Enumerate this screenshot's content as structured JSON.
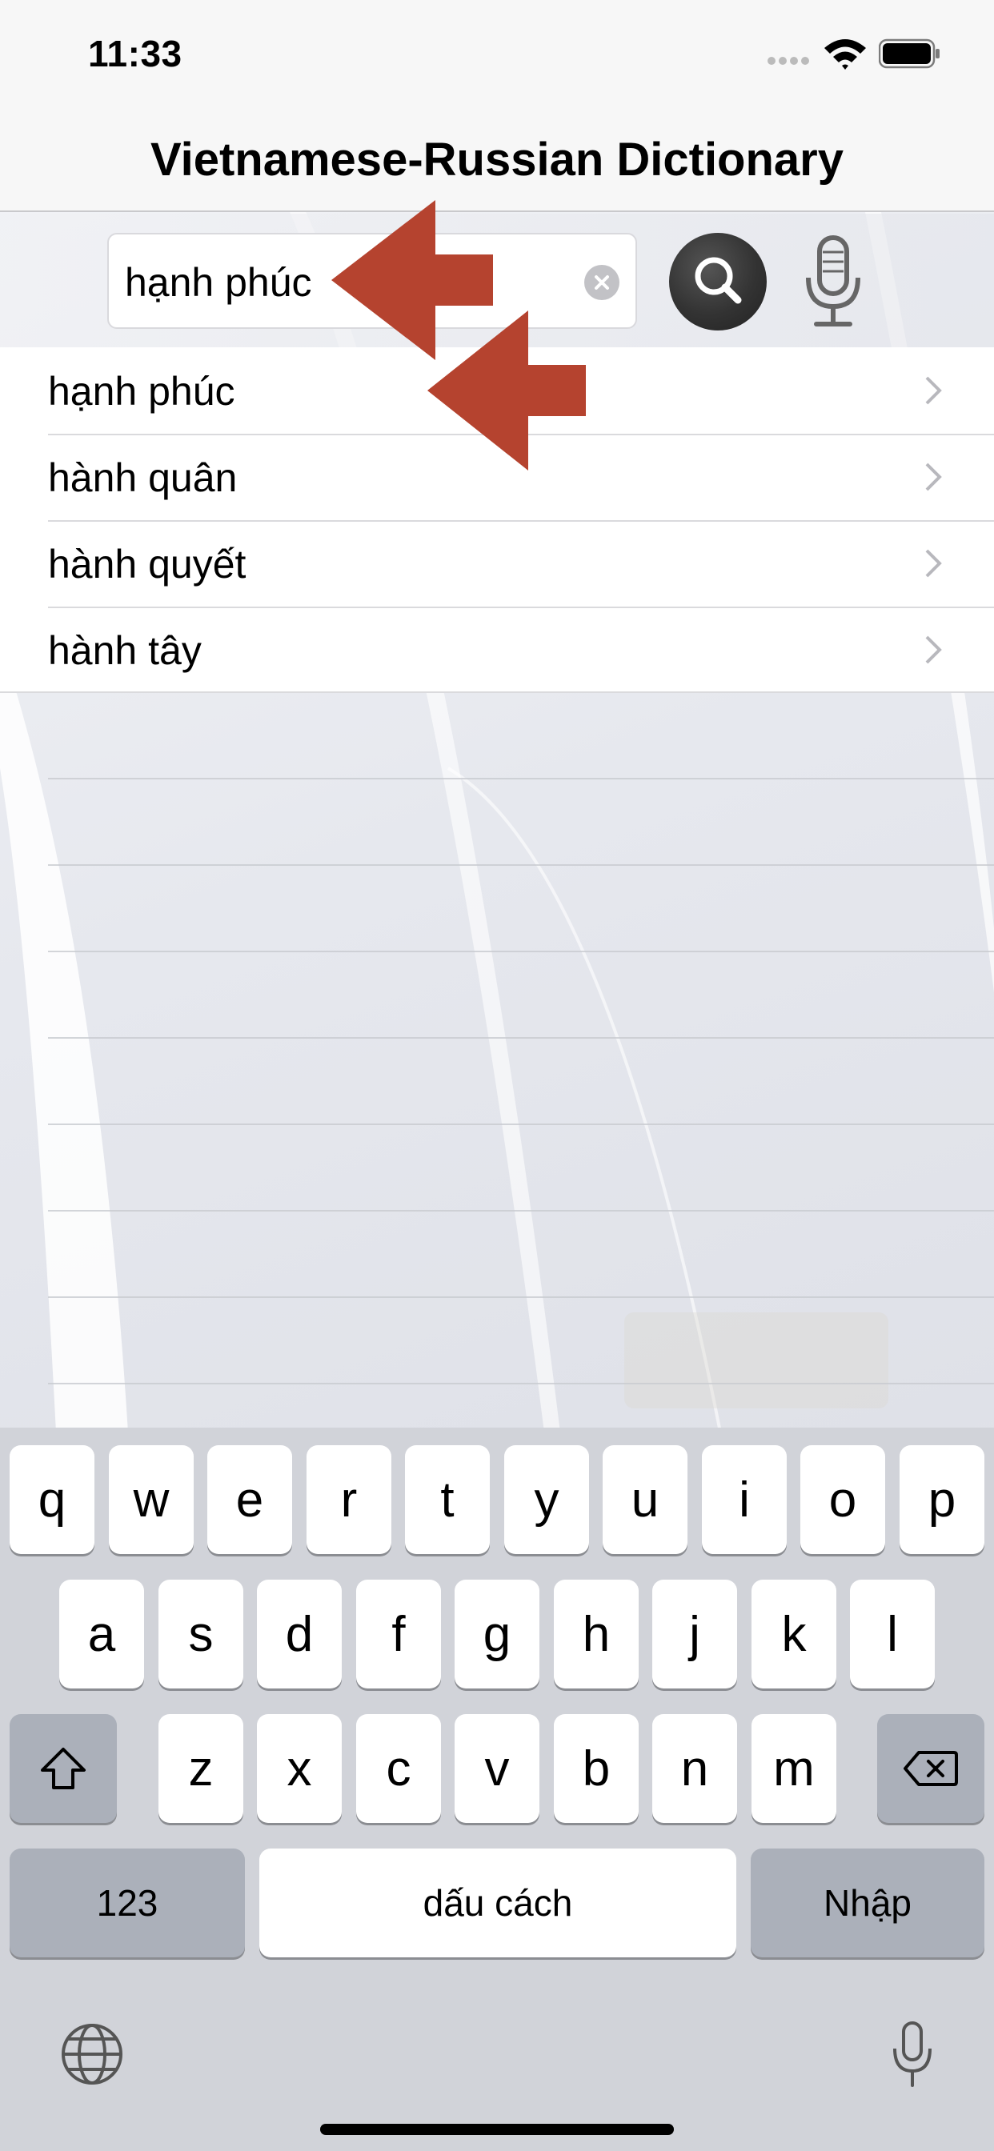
{
  "status_bar": {
    "time": "11:33"
  },
  "nav": {
    "title": "Vietnamese-Russian Dictionary"
  },
  "search": {
    "value": "hạnh phúc"
  },
  "suggestions": [
    {
      "label": "hạnh phúc"
    },
    {
      "label": "hành quân"
    },
    {
      "label": "hành quyết"
    },
    {
      "label": "hành tây"
    }
  ],
  "keyboard": {
    "row1": [
      "q",
      "w",
      "e",
      "r",
      "t",
      "y",
      "u",
      "i",
      "o",
      "p"
    ],
    "row2": [
      "a",
      "s",
      "d",
      "f",
      "g",
      "h",
      "j",
      "k",
      "l"
    ],
    "row3": [
      "z",
      "x",
      "c",
      "v",
      "b",
      "n",
      "m"
    ],
    "numbers_label": "123",
    "space_label": "dấu cách",
    "return_label": "Nhập"
  },
  "colors": {
    "arrow": "#b5432f",
    "search_button": "#333333"
  },
  "icons": [
    "signal-icon",
    "wifi-icon",
    "battery-icon",
    "clear-icon",
    "search-icon",
    "microphone-icon",
    "chevron-right-icon",
    "shift-icon",
    "delete-icon",
    "globe-icon",
    "dictation-icon"
  ]
}
